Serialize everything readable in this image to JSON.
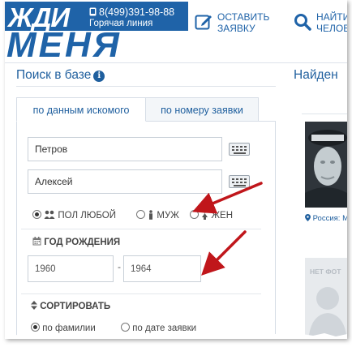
{
  "header": {
    "logo_top": "ЖДИ",
    "logo_bottom": "МЕНЯ",
    "phone": "8(499)391-98-88",
    "hotline": "Горячая линия",
    "action_submit": {
      "line1": "ОСТАВИТЬ",
      "line2": "ЗАЯВКУ",
      "icon": "edit-icon"
    },
    "action_find": {
      "line1": "НАЙТИ",
      "line2": "ЧЕЛОВ",
      "icon": "search-icon"
    }
  },
  "search": {
    "title": "Поиск в базе",
    "tabs": [
      {
        "label": "по данным искомого",
        "active": true
      },
      {
        "label": "по номеру заявки",
        "active": false
      }
    ],
    "last_name": "Петров",
    "first_name": "Алексей",
    "gender": {
      "label": "ПОЛ ЛЮБОЙ",
      "male": "МУЖ",
      "female": "ЖЕН",
      "selected": "any"
    },
    "birth_year": {
      "label": "ГОД РОЖДЕНИЯ",
      "from": "1960",
      "separator": "-",
      "to": "1964"
    },
    "sort": {
      "label": "СОРТИРОВАТЬ",
      "by_surname": "по фамилии",
      "by_date": "по дате заявки",
      "selected": "surname"
    }
  },
  "found": {
    "title": "Найден",
    "location": "Россия: Мо",
    "no_photo": "НЕТ ФОТ"
  },
  "colors": {
    "brand_blue": "#1f63a8",
    "link_blue": "#1f5f9e",
    "annotation_red": "#c0161b"
  }
}
